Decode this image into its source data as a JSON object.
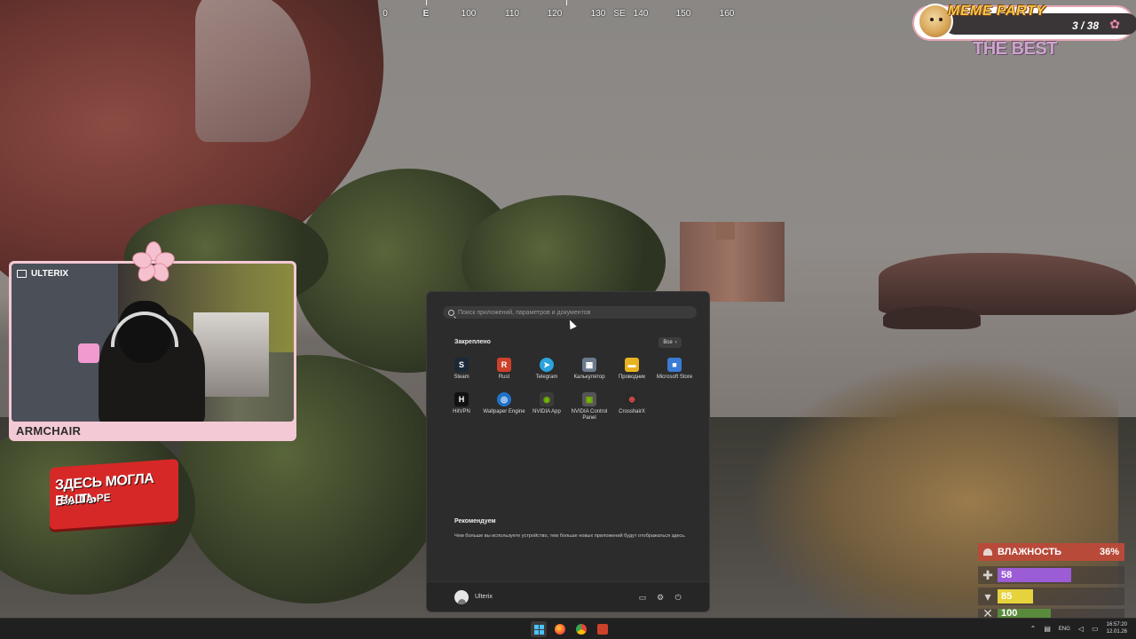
{
  "hud": {
    "compass": {
      "ticks": [
        "0",
        "E",
        "100",
        "110",
        "120",
        "130",
        "SE",
        "140",
        "150",
        "160"
      ]
    },
    "meme_party": {
      "title": "MEME PARTY",
      "count": "3 / 38",
      "subtitle": "THE BEST"
    },
    "webcam": {
      "platform_label": "ULTERIX",
      "name": "ARMCHAIR"
    },
    "ad": {
      "line1": "ЗДЕСЬ МОГЛА БЫТЬ",
      "line2": "ВАША РЕ"
    },
    "stats": {
      "humidity_label": "ВЛАЖНОСТЬ",
      "humidity_value": "36%",
      "health": "58",
      "health_fraction": 0.58,
      "health_color": "#9b5cd6",
      "food": "85",
      "food_fraction": 0.28,
      "food_color": "#e6d23d",
      "water": "100"
    }
  },
  "start_menu": {
    "search_placeholder": "Поиск приложений, параметров и документов",
    "pinned_title": "Закреплено",
    "all_button": "Все",
    "apps": [
      {
        "label": "Steam",
        "icon": "steam-icon",
        "color": "#1b2838",
        "glyph": "S"
      },
      {
        "label": "Rust",
        "icon": "rust-icon",
        "color": "#cd412b",
        "glyph": "R"
      },
      {
        "label": "Telegram",
        "icon": "telegram-icon",
        "color": "#2aa3df",
        "glyph": "➤"
      },
      {
        "label": "Калькулятор",
        "icon": "calculator-icon",
        "color": "#6b7a8c",
        "glyph": "▦"
      },
      {
        "label": "Проводник",
        "icon": "folder-icon",
        "color": "#e8b320",
        "glyph": "▬"
      },
      {
        "label": "Microsoft Store",
        "icon": "store-icon",
        "color": "#3a7bd5",
        "glyph": "■"
      },
      {
        "label": "HitVPN",
        "icon": "hitvpn-icon",
        "color": "#111111",
        "glyph": "H"
      },
      {
        "label": "Wallpaper Engine",
        "icon": "wallpaper-engine-icon",
        "color": "#1f73c9",
        "glyph": "◎"
      },
      {
        "label": "NVIDIA App",
        "icon": "nvidia-app-icon",
        "color": "#3b3b3b",
        "glyph": "◉"
      },
      {
        "label": "NVIDIA Control Panel",
        "icon": "nvidia-control-panel-icon",
        "color": "#555555",
        "glyph": "▣"
      },
      {
        "label": "CrosshairX",
        "icon": "crosshairx-icon",
        "color": "#2a2a2a",
        "glyph": "⊕"
      }
    ],
    "recommended_title": "Рекомендуем",
    "recommended_text": "Чем больше вы используете устройство, тем больше новых приложений будут отображаться здесь.",
    "user_name": "Ulterix"
  },
  "taskbar": {
    "lang": "ENG",
    "time": "16:57:20",
    "date": "12.01.26"
  }
}
